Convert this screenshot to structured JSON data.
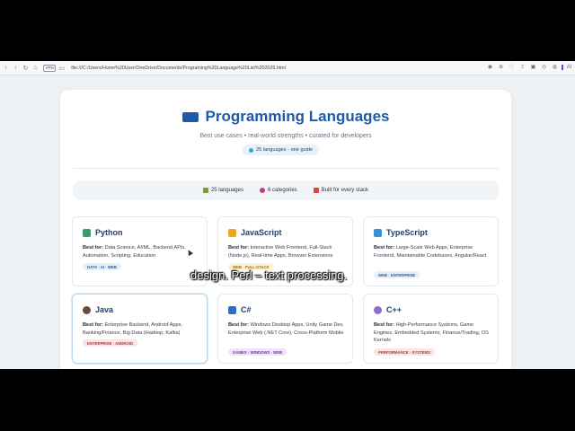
{
  "browser": {
    "vpn_label": "VPN",
    "url": "file:///C:/Users/Home%20User/OneDrive/Documents/Programing%20Language%20List%202026.html",
    "ai_label": "AI"
  },
  "header": {
    "title": "Programming Languages",
    "subtitle": "Best use cases • real-world strengths • curated for developers",
    "pill": "25 languages · one guide"
  },
  "stats": [
    {
      "label": "25 languages",
      "icon": "books-icon",
      "color": "#7c9a3b"
    },
    {
      "label": "6 categories",
      "icon": "target-icon",
      "color": "#c2378a"
    },
    {
      "label": "Built for every stack",
      "icon": "rocket-icon",
      "color": "#d9463b"
    }
  ],
  "cards": [
    {
      "name": "Python",
      "best_label": "Best for:",
      "desc": "Data Science, AI/ML, Backend APIs, Automation, Scripting, Education",
      "tag": "DATA · AI · WEB",
      "icon": "python-icon",
      "icon_color": "#3c9a6a",
      "tag_bg": "#e4f0fb",
      "tag_fg": "#2d5f91"
    },
    {
      "name": "JavaScript",
      "best_label": "Best for:",
      "desc": "Interactive Web Frontend, Full-Stack (Node.js), Real-time Apps, Browser Extensions",
      "tag": "WEB · FULL-STACK",
      "icon": "lightning-icon",
      "icon_color": "#f0a521",
      "tag_bg": "#fdf2dc",
      "tag_fg": "#a26b0c"
    },
    {
      "name": "TypeScript",
      "best_label": "Best for:",
      "desc": "Large-Scale Web Apps, Enterprise Frontend, Maintainable Codebases, Angular/React",
      "tag": "WEB · ENTERPRISE",
      "icon": "book-icon",
      "icon_color": "#3a8fd6",
      "tag_bg": "#e4f0fb",
      "tag_fg": "#2d5f91"
    },
    {
      "name": "Java",
      "best_label": "Best for:",
      "desc": "Enterprise Backend, Android Apps, Banking/Finance, Big Data (Hadoop, Kafka)",
      "tag": "ENTERPRISE · ANDROID",
      "icon": "java-icon",
      "icon_color": "#6b4a3a",
      "tag_bg": "#fde3e3",
      "tag_fg": "#b03a3a"
    },
    {
      "name": "C#",
      "best_label": "Best for:",
      "desc": "Windows Desktop Apps, Unity Game Dev, Enterprise Web (.NET Core), Cross-Platform Mobile",
      "tag": "GAMES · WINDOWS · WEB",
      "icon": "square-icon",
      "icon_color": "#2e6fc2",
      "tag_bg": "#efe3fb",
      "tag_fg": "#6a3aa6"
    },
    {
      "name": "C++",
      "best_label": "Best for:",
      "desc": "High-Performance Systems, Game Engines, Embedded Systems, Finance/Trading, OS Kernels",
      "tag": "PERFORMANCE · SYSTEMS",
      "icon": "gear-icon",
      "icon_color": "#8a6fc2",
      "tag_bg": "#fde3e3",
      "tag_fg": "#b03a3a"
    }
  ],
  "caption": "design. Perl – text processing."
}
